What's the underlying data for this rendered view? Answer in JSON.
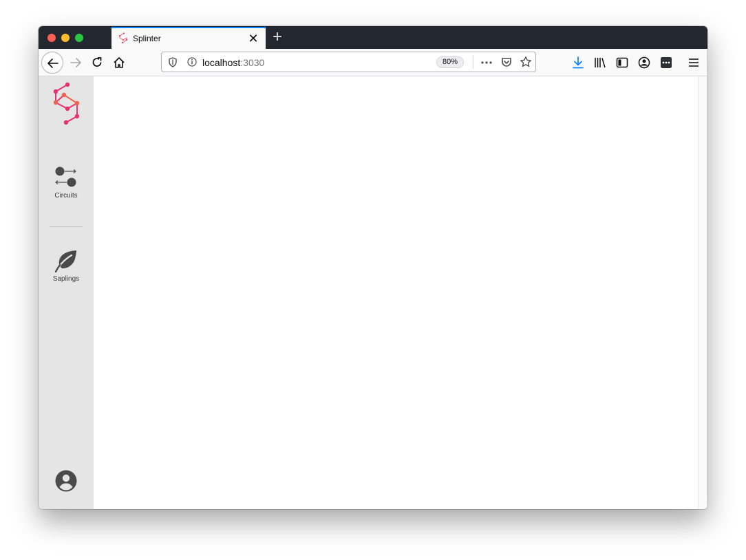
{
  "browser": {
    "tab": {
      "title": "Splinter"
    },
    "url": {
      "host": "localhost",
      "port": ":3030"
    },
    "zoom": "80%"
  },
  "sidebar": {
    "items": [
      {
        "label": "Circuits",
        "icon": "circuits-icon"
      },
      {
        "label": "Saplings",
        "icon": "leaf-icon"
      }
    ],
    "account_icon": "account-circle-icon"
  },
  "colors": {
    "brand_pink": "#e8316f",
    "brand_orange": "#f0624f",
    "sidebar_bg": "#e5e5e5",
    "icon_dark": "#4a4a4a"
  }
}
